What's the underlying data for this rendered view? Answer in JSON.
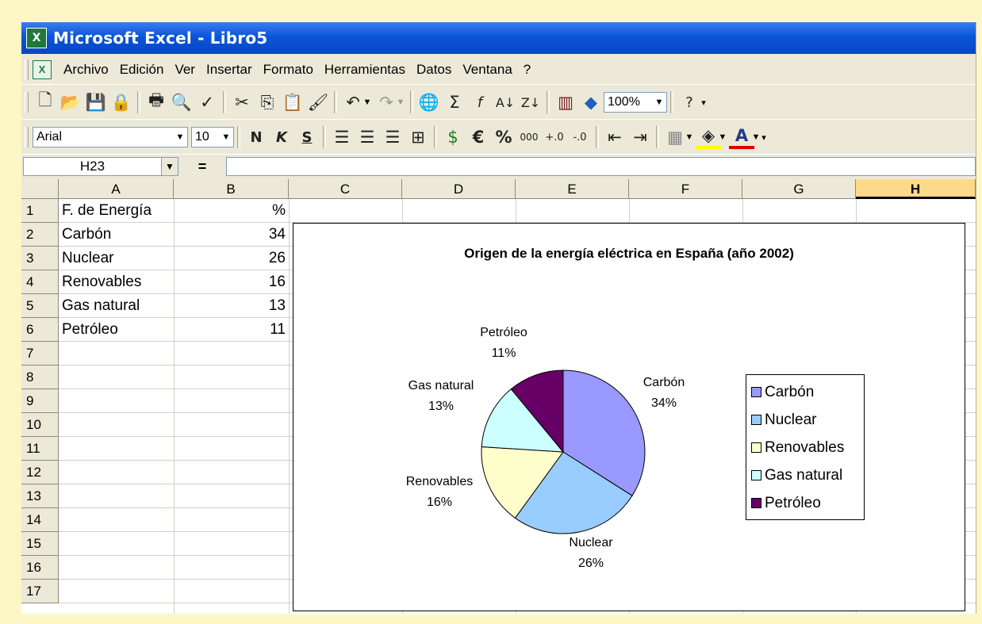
{
  "window": {
    "title": "Microsoft Excel - Libro5"
  },
  "menu": [
    "Archivo",
    "Edición",
    "Ver",
    "Insertar",
    "Formato",
    "Herramientas",
    "Datos",
    "Ventana",
    "?"
  ],
  "toolbar": {
    "zoom": "100%"
  },
  "format_toolbar": {
    "font": "Arial",
    "size": "10",
    "bold": "N",
    "italic": "K",
    "underline": "S",
    "percent": "%",
    "euro": "€",
    "thousands": "000"
  },
  "formula_bar": {
    "name_box": "H23",
    "equals": "="
  },
  "columns": [
    "A",
    "B",
    "C",
    "D",
    "E",
    "F",
    "G",
    "H"
  ],
  "rows": [
    "1",
    "2",
    "3",
    "4",
    "5",
    "6",
    "7",
    "8",
    "9",
    "10",
    "11",
    "12",
    "13",
    "14",
    "15",
    "16",
    "17"
  ],
  "cells": {
    "A1": "F. de Energía",
    "B1": "%",
    "A2": "Carbón",
    "B2": "34",
    "A3": "Nuclear",
    "B3": "26",
    "A4": "Renovables",
    "B4": "16",
    "A5": "Gas natural",
    "B5": "13",
    "A6": "Petróleo",
    "B6": "11"
  },
  "chart_data": {
    "type": "pie",
    "title": "Origen de la energía eléctrica en España (año 2002)",
    "categories": [
      "Carbón",
      "Nuclear",
      "Renovables",
      "Gas natural",
      "Petróleo"
    ],
    "values": [
      34,
      26,
      16,
      13,
      11
    ],
    "labels": [
      "34%",
      "26%",
      "16%",
      "13%",
      "11%"
    ],
    "colors": [
      "#9999ff",
      "#99ccff",
      "#ffffcc",
      "#ccffff",
      "#660066"
    ],
    "legend": "right"
  }
}
